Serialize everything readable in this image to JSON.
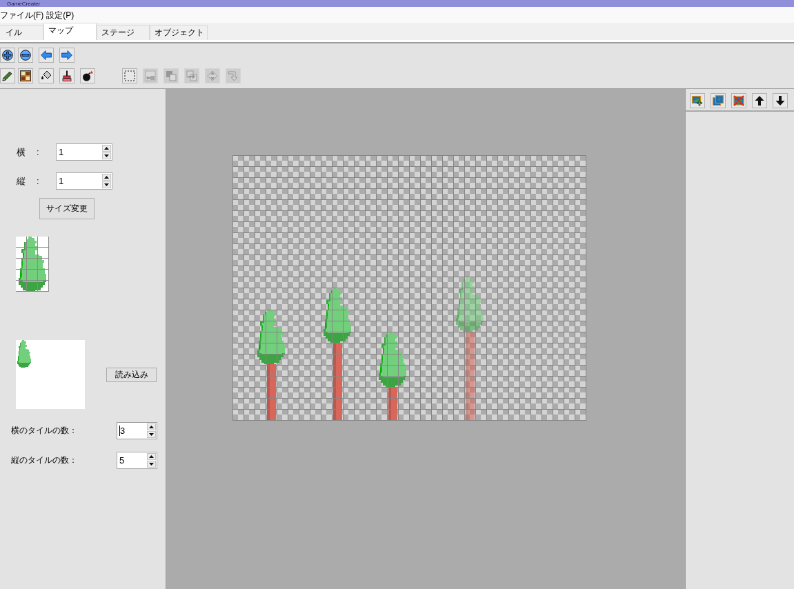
{
  "window": {
    "title": "GameCreater"
  },
  "menu": [
    "ファイル(F)",
    "設定(P)"
  ],
  "tabs": [
    {
      "label": "イル",
      "selected": false
    },
    {
      "label": "マップ",
      "selected": true
    },
    {
      "label": "ステージ",
      "selected": false
    },
    {
      "label": "オブジェクト",
      "selected": false
    }
  ],
  "toolbar": {
    "row_1": [
      {
        "disabled": false
      },
      {
        "disabled": false
      },
      {
        "disabled": false
      },
      {
        "disabled": false
      }
    ],
    "row_2": [
      [
        {
          "disabled": false
        },
        {
          "disabled": false
        },
        {
          "disabled": false
        },
        {
          "disabled": false
        },
        {
          "disabled": false
        }
      ],
      [
        {
          "disabled": false
        },
        {
          "disabled": true
        },
        {
          "disabled": true
        },
        {
          "disabled": true
        },
        {
          "disabled": true
        },
        {
          "disabled": true
        }
      ]
    ]
  },
  "size_panel": {
    "width": {
      "label": "横",
      "separator": ":",
      "value": "1",
      "focused": false
    },
    "height": {
      "label": "縦",
      "separator": ":",
      "value": "1",
      "focused": false
    },
    "resize_button": "サイズ変更"
  },
  "tileset": {
    "load_button": "読み込み",
    "columns": {
      "label": "横のタイルの数：",
      "value": "3",
      "focused": true
    },
    "rows": {
      "label": "縦のタイルの数：",
      "value": "5",
      "focused": false
    }
  },
  "map": {
    "objects": [
      {
        "kind": "tree",
        "translucent": false
      },
      {
        "kind": "tree",
        "translucent": false
      },
      {
        "kind": "tree",
        "translucent": false
      },
      {
        "kind": "tree",
        "translucent": true
      }
    ]
  },
  "layer_toolbar": [
    {
      "disabled": false
    },
    {
      "disabled": false
    },
    {
      "disabled": false
    },
    {
      "disabled": false
    },
    {
      "disabled": false
    }
  ]
}
